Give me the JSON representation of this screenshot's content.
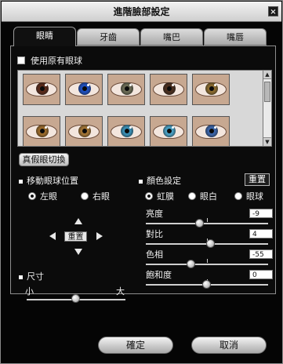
{
  "window": {
    "title": "進階臉部設定",
    "close_glyph": "×"
  },
  "tabs": [
    {
      "label": "眼睛",
      "active": true
    },
    {
      "label": "牙齒",
      "active": false
    },
    {
      "label": "嘴巴",
      "active": false
    },
    {
      "label": "嘴唇",
      "active": false
    }
  ],
  "eyes_panel": {
    "use_original_label": "使用原有眼球",
    "use_original_checked": false,
    "thumbnails": [
      {
        "iris_color": "#5a2a1a"
      },
      {
        "iris_color": "#1e4fbf"
      },
      {
        "iris_color": "#6b6b55"
      },
      {
        "iris_color": "#4a2e1e"
      },
      {
        "iris_color": "#8a6a2e"
      },
      {
        "iris_color": "#9a6a2a"
      },
      {
        "iris_color": "#a27434"
      },
      {
        "iris_color": "#3a8fb5"
      },
      {
        "iris_color": "#4aa0c4"
      },
      {
        "iris_color": "#3b64a8"
      }
    ],
    "swap_button": "真假眼切換",
    "move_section": {
      "title": "移動眼球位置",
      "left_eye": "左眼",
      "right_eye": "右眼",
      "selected": "左眼",
      "reset_label": "重置"
    },
    "size_section": {
      "title": "尺寸",
      "min_label": "小",
      "max_label": "大",
      "value_fraction": 0.5
    },
    "color_section": {
      "title": "顏色設定",
      "reset_button": "重置",
      "iris": "虹膜",
      "white": "眼白",
      "eyeball": "眼球",
      "selected": "虹膜",
      "sliders": [
        {
          "label": "亮度",
          "value": "-9",
          "fraction": 0.44
        },
        {
          "label": "對比",
          "value": "4",
          "fraction": 0.53
        },
        {
          "label": "色相",
          "value": "-55",
          "fraction": 0.37
        },
        {
          "label": "飽和度",
          "value": "0",
          "fraction": 0.5
        }
      ]
    }
  },
  "footer": {
    "ok": "確定",
    "cancel": "取消"
  },
  "colors": {
    "background": "#050505",
    "accent": "#ffffff"
  }
}
